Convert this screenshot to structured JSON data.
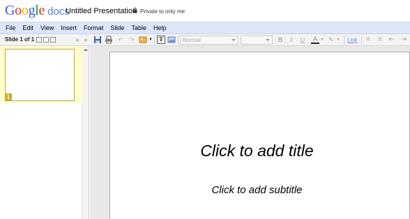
{
  "header": {
    "logo_google": [
      "G",
      "o",
      "o",
      "g",
      "l",
      "e"
    ],
    "logo_docs": "docs",
    "doc_title": "Untitled Presentation",
    "privacy": "Private to only me"
  },
  "menu": [
    "File",
    "Edit",
    "View",
    "Insert",
    "Format",
    "Slide",
    "Table",
    "Help"
  ],
  "toolbar": {
    "slide_count": "Slide 1 of 1",
    "style_select": "Normal",
    "bold": "B",
    "italic": "I",
    "underline": "U",
    "text_color": "A",
    "link": "Link",
    "textbox": "T"
  },
  "thumbnails": [
    {
      "number": "1"
    }
  ],
  "slide": {
    "title_placeholder": "Click to add title",
    "subtitle_placeholder": "Click to add subtitle"
  },
  "colors": {
    "menubar": "#dde6f8",
    "thumb_selected": "#ffffcc",
    "thumb_badge": "#c9ac2c",
    "link": "#6f8fd8"
  }
}
